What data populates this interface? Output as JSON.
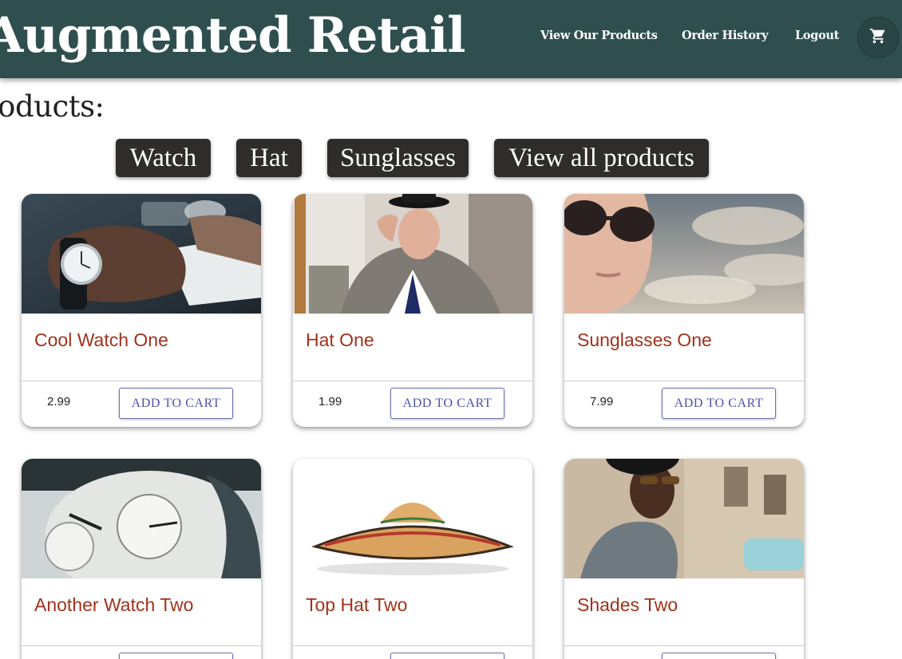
{
  "header": {
    "brand": "Augmented Retail",
    "nav": {
      "products": "View Our Products",
      "history": "Order History",
      "logout": "Logout"
    },
    "cart_icon": "cart-icon"
  },
  "heading": "roducts:",
  "filters": [
    "Watch",
    "Hat",
    "Sunglasses",
    "View all products"
  ],
  "add_to_cart_label": "ADD TO CART",
  "products": [
    {
      "title": "Cool Watch One",
      "price": "2.99"
    },
    {
      "title": "Hat One",
      "price": "1.99"
    },
    {
      "title": "Sunglasses One",
      "price": "7.99"
    },
    {
      "title": "Another Watch Two",
      "price": ""
    },
    {
      "title": "Top Hat Two",
      "price": ""
    },
    {
      "title": "Shades Two",
      "price": ""
    }
  ],
  "colors": {
    "header_bg": "#2f4f4f",
    "filter_bg": "#2e2d2b",
    "title_red": "#a1321b",
    "button_blue": "#4b52a8"
  }
}
